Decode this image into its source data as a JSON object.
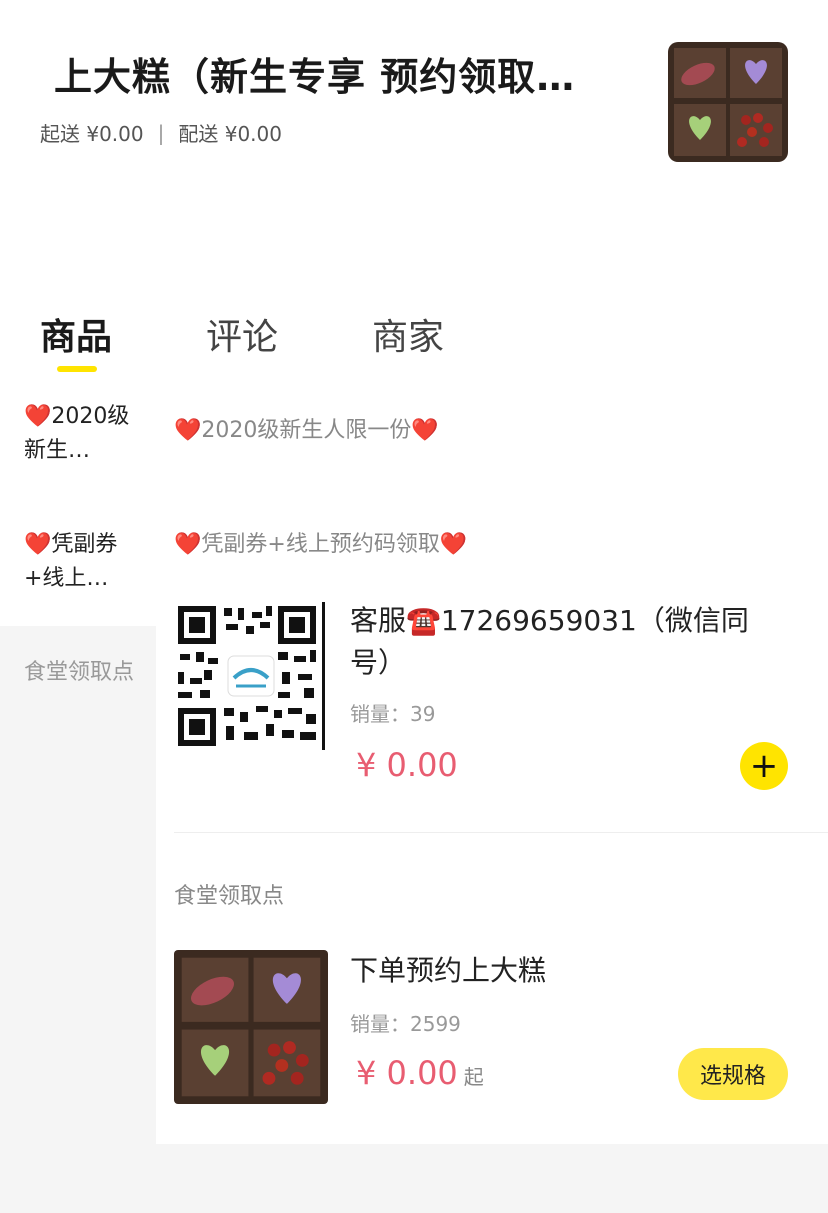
{
  "shop": {
    "title": "上大糕（新生专享 预约领取…",
    "min_order": "起送 ¥0.00",
    "separator": "|",
    "delivery": "配送 ¥0.00"
  },
  "tabs": [
    {
      "label": "商品"
    },
    {
      "label": "评论"
    },
    {
      "label": "商家"
    }
  ],
  "sidebar": {
    "items": [
      {
        "label": "❤️2020级新生…"
      },
      {
        "label": "❤️凭副券+线上…"
      },
      {
        "label": "食堂领取点"
      }
    ]
  },
  "sections": [
    {
      "heading": "❤️2020级新生人限一份❤️"
    },
    {
      "heading": "❤️凭副券+线上预约码领取❤️"
    },
    {
      "heading": "食堂领取点"
    }
  ],
  "products": [
    {
      "title": "客服☎️17269659031（微信同号）",
      "sales": "销量：39",
      "price": "¥ 0.00",
      "action": "+"
    },
    {
      "title": "下单预约上大糕",
      "sales": "销量：2599",
      "price": "¥ 0.00",
      "price_suffix": "起",
      "action": "选规格"
    }
  ],
  "colors": {
    "accent": "#ffe400",
    "price": "#e85d71"
  }
}
